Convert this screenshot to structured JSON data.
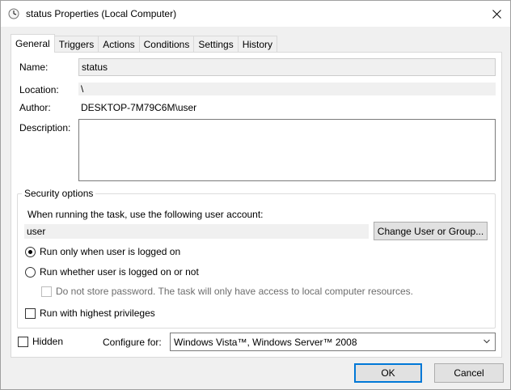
{
  "window": {
    "title": "status Properties (Local Computer)",
    "icons": {
      "title": "clock-icon",
      "close": "close-icon"
    }
  },
  "tabs": [
    {
      "label": "General",
      "active": true
    },
    {
      "label": "Triggers",
      "active": false
    },
    {
      "label": "Actions",
      "active": false
    },
    {
      "label": "Conditions",
      "active": false
    },
    {
      "label": "Settings",
      "active": false
    },
    {
      "label": "History",
      "active": false
    }
  ],
  "general": {
    "name_label": "Name:",
    "name_value": "status",
    "location_label": "Location:",
    "location_value": "\\",
    "author_label": "Author:",
    "author_value": "DESKTOP-7M79C6M\\user",
    "description_label": "Description:",
    "description_value": ""
  },
  "security": {
    "group_title": "Security options",
    "account_prompt": "When running the task, use the following user account:",
    "account_value": "user",
    "change_button": "Change User or Group...",
    "radio_logged_on": "Run only when user is logged on",
    "radio_logged_on_selected": true,
    "radio_whether": "Run whether user is logged on or not",
    "radio_whether_selected": false,
    "no_store_password": "Do not store password.  The task will only have access to local computer resources.",
    "no_store_password_checked": false,
    "highest_privileges": "Run with highest privileges",
    "highest_privileges_checked": false
  },
  "footer": {
    "hidden_label": "Hidden",
    "hidden_checked": false,
    "configure_label": "Configure for:",
    "configure_value": "Windows Vista™, Windows Server™ 2008"
  },
  "buttons": {
    "ok": "OK",
    "cancel": "Cancel"
  },
  "colors": {
    "accent": "#0078d7",
    "window_bg": "#f0f0f0",
    "panel_bg": "#ffffff"
  }
}
